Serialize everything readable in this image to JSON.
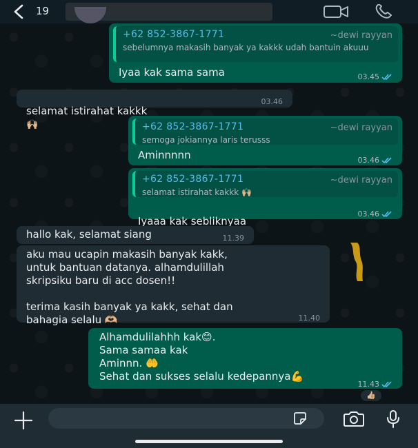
{
  "header": {
    "unread_count": "19",
    "icons": [
      "back-chevron-icon",
      "video-call-icon",
      "voice-call-icon"
    ]
  },
  "messages": [
    {
      "direction": "out",
      "quote": {
        "phone": "+62 852-3867-1771",
        "name": "~dewi rayyan",
        "text": "sebelumnya makasih banyak ya kakkk udah bantuin akuuu"
      },
      "text": "Iyaa kak sama sama",
      "time": "03.45"
    },
    {
      "direction": "in",
      "text": "selamat istirahat kakkk",
      "emoji": "🙌🏼",
      "time": "03.46"
    },
    {
      "direction": "out",
      "quote": {
        "phone": "+62 852-3867-1771",
        "name": "~dewi rayyan",
        "text": "semoga jokiannya laris terusss"
      },
      "text": "Aminnnnn",
      "time": "03.46"
    },
    {
      "direction": "out",
      "quote": {
        "phone": "+62 852-3867-1771",
        "name": "~dewi rayyan",
        "text": "selamat istirahat kakkk 🙌🏼"
      },
      "text": "Iyaaa kak sebliknyaa",
      "emoji": "👋",
      "time": "03.46"
    },
    {
      "direction": "in",
      "text": "hallo kak, selamat siang",
      "time": "11.39"
    },
    {
      "direction": "in",
      "text": "aku mau ucapin makasih banyak kakk,\nuntuk bantuan datanya. alhamdulillah\nskripsiku baru di acc dosen!!\n\nterima kasih banyak ya kakk, sehat dan\nbahagia selalu 🫶🏼",
      "time": "11.40"
    },
    {
      "direction": "out",
      "text": "Alhamdulilahhh kak😊.\nSama samaa kak\nAminnn. 🤲\nSehat dan sukses selalu kedepannya💪",
      "time": "11.43"
    }
  ],
  "reaction": "👍🏼",
  "colors": {
    "outgoing_bubble": "#005c4b",
    "incoming_bubble": "#202c33",
    "quote_accent": "#06cf9c",
    "read_ticks": "#53bdeb"
  },
  "input_bar": {
    "icons": [
      "plus-icon",
      "sticker-icon",
      "camera-icon",
      "microphone-icon"
    ]
  }
}
